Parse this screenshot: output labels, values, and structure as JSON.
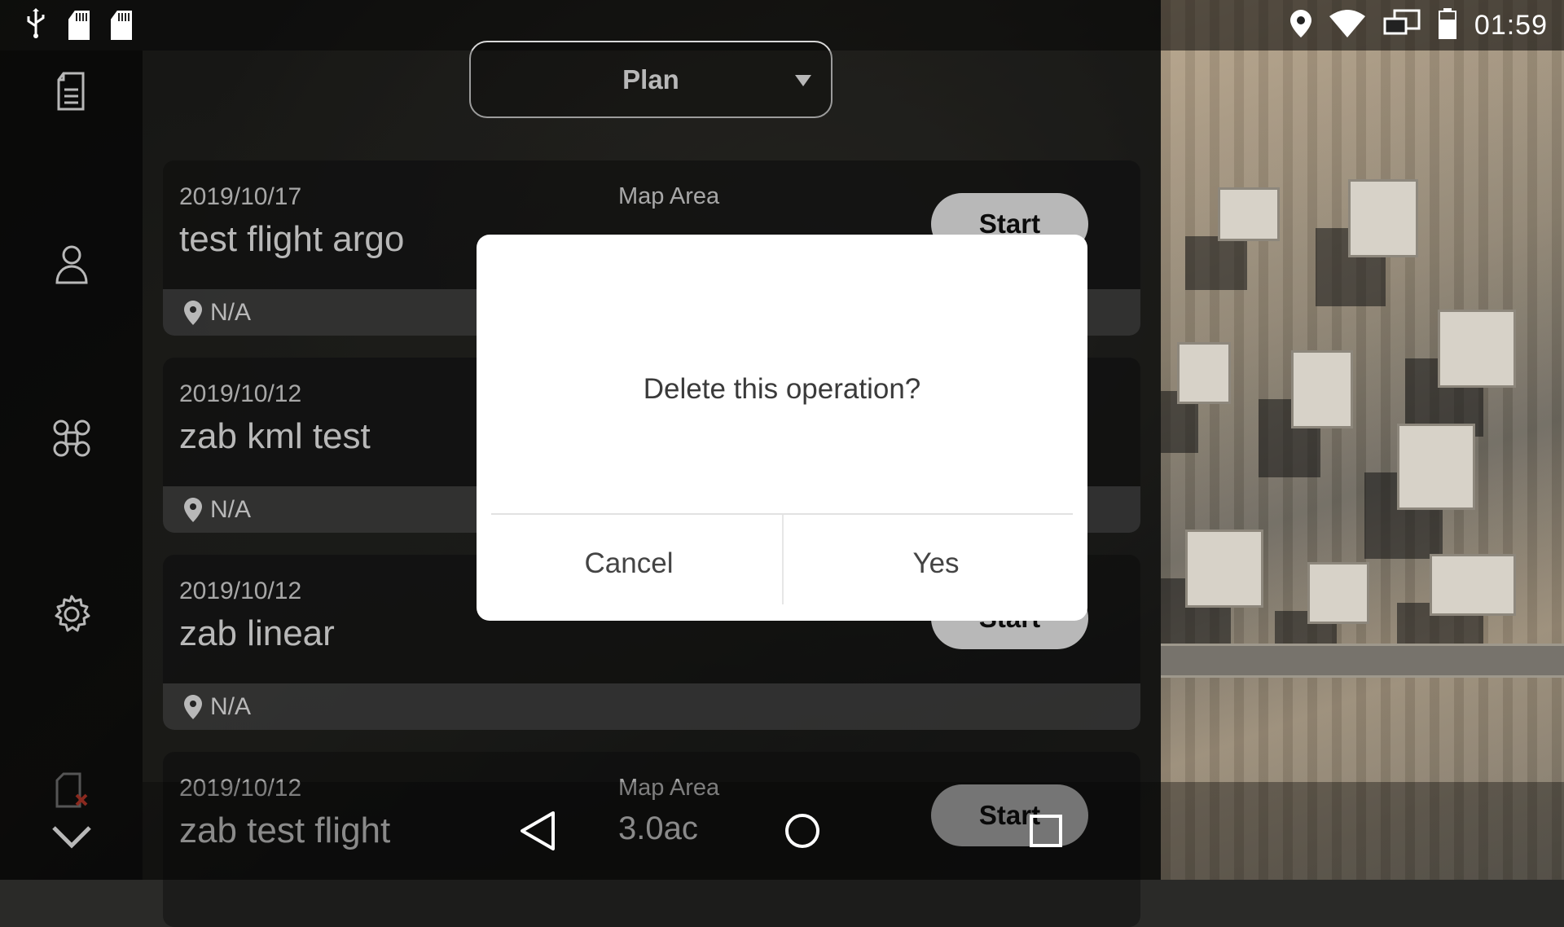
{
  "status_bar": {
    "time": "01:59",
    "left_icons": [
      "usb-icon",
      "sd-card-icon",
      "sd-card-icon"
    ],
    "right_icons": [
      "location-icon",
      "wifi-icon",
      "screen-mirror-icon",
      "battery-icon"
    ]
  },
  "sidebar": {
    "items": [
      {
        "icon": "document-icon"
      },
      {
        "icon": "user-icon"
      },
      {
        "icon": "drone-icon"
      },
      {
        "icon": "gear-icon"
      },
      {
        "icon": "sd-card-error-icon"
      },
      {
        "icon": "chevron-down-icon"
      }
    ]
  },
  "header": {
    "dropdown_value": "Plan"
  },
  "operations": [
    {
      "date": "2019/10/17",
      "title": "test flight argo",
      "map_area_label": "Map Area",
      "map_area_value": "",
      "location": "N/A",
      "start_label": "Start"
    },
    {
      "date": "2019/10/12",
      "title": "zab kml test",
      "map_area_label": "",
      "map_area_value": "",
      "location": "N/A",
      "start_label": ""
    },
    {
      "date": "2019/10/12",
      "title": "zab linear",
      "map_area_label": "",
      "map_area_value": "",
      "location": "N/A",
      "start_label": "Start"
    },
    {
      "date": "2019/10/12",
      "title": "zab test flight",
      "map_area_label": "Map Area",
      "map_area_value": "3.0ac",
      "location": "",
      "start_label": "Start"
    }
  ],
  "dialog": {
    "message": "Delete this operation?",
    "cancel_label": "Cancel",
    "confirm_label": "Yes"
  },
  "navigation": {
    "icons": [
      "back-icon",
      "home-icon",
      "recents-icon"
    ]
  },
  "colors": {
    "card_bg": "#141414",
    "dialog_bg": "#ffffff",
    "button_bg": "#ffffff"
  }
}
